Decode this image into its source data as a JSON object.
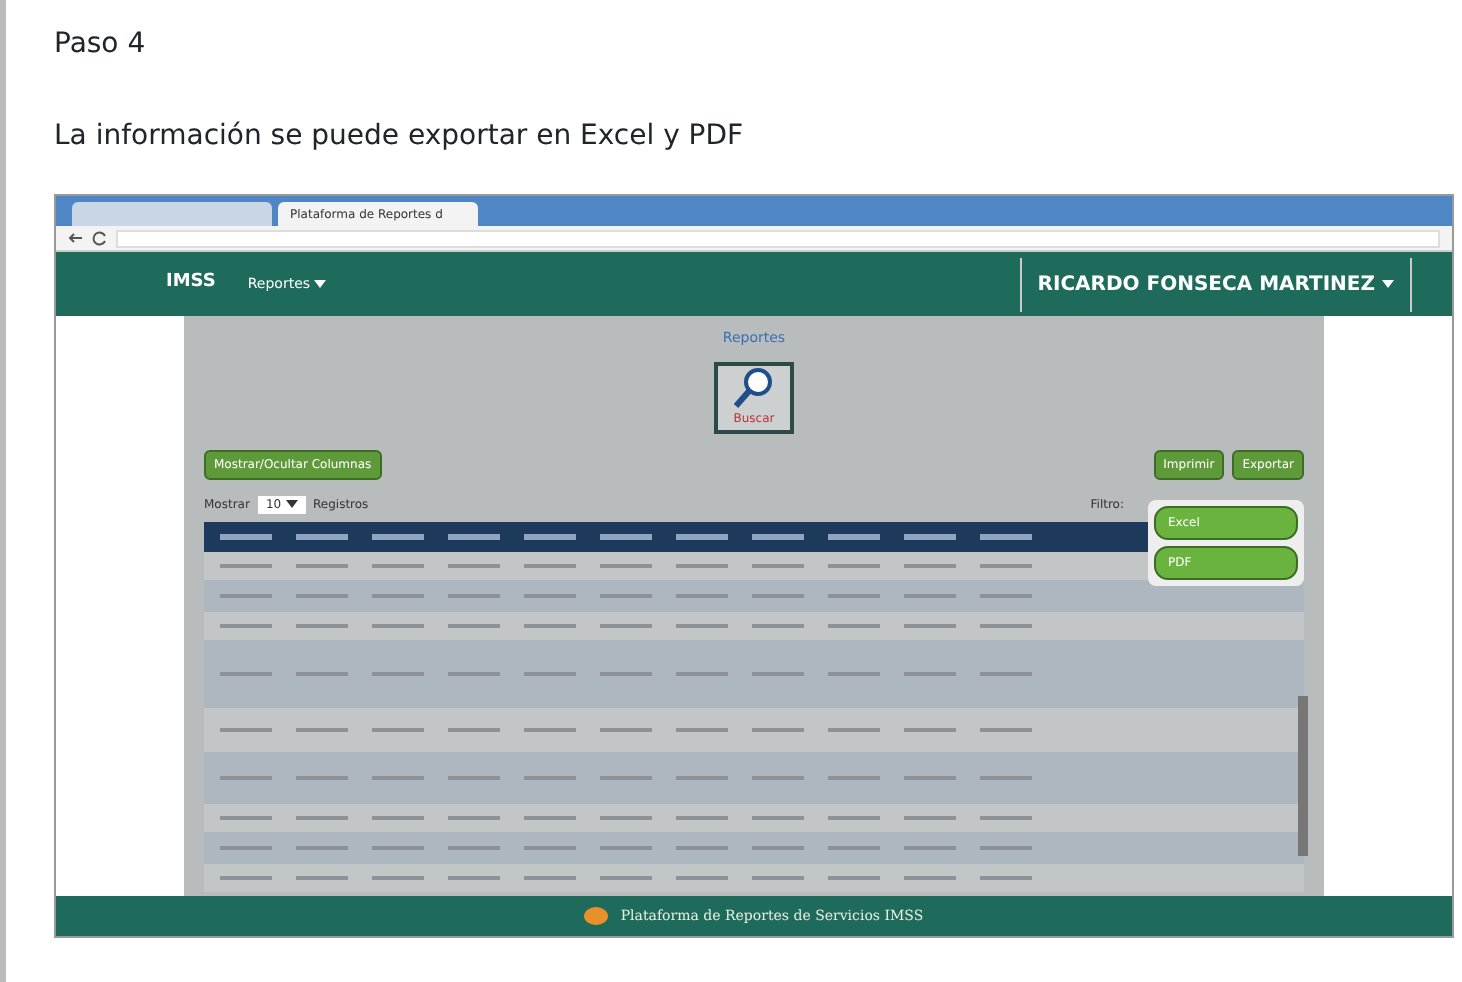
{
  "document": {
    "step": "Paso 4",
    "sentence": "La información se puede exportar en Excel y PDF"
  },
  "browser": {
    "tabs": [
      {
        "selected": false
      },
      {
        "label": "Plataforma de Reportes d",
        "selected": true
      }
    ]
  },
  "navbar": {
    "brand": "IMSS",
    "menu": "Reportes",
    "user": "RICARDO FONSECA MARTINEZ"
  },
  "modal": {
    "title": "Reportes",
    "search_button": "Buscar",
    "columns_button": "Mostrar/Ocultar Columnas",
    "buttons": [
      "Imprimir",
      "Exportar"
    ],
    "export_menu": [
      "Excel",
      "PDF"
    ],
    "length_label": "Mostrar",
    "length_value": "10",
    "length_suffix": "Registros",
    "filter_label": "Filtro:"
  },
  "footer": "Plataforma de Reportes de Servicios IMSS"
}
